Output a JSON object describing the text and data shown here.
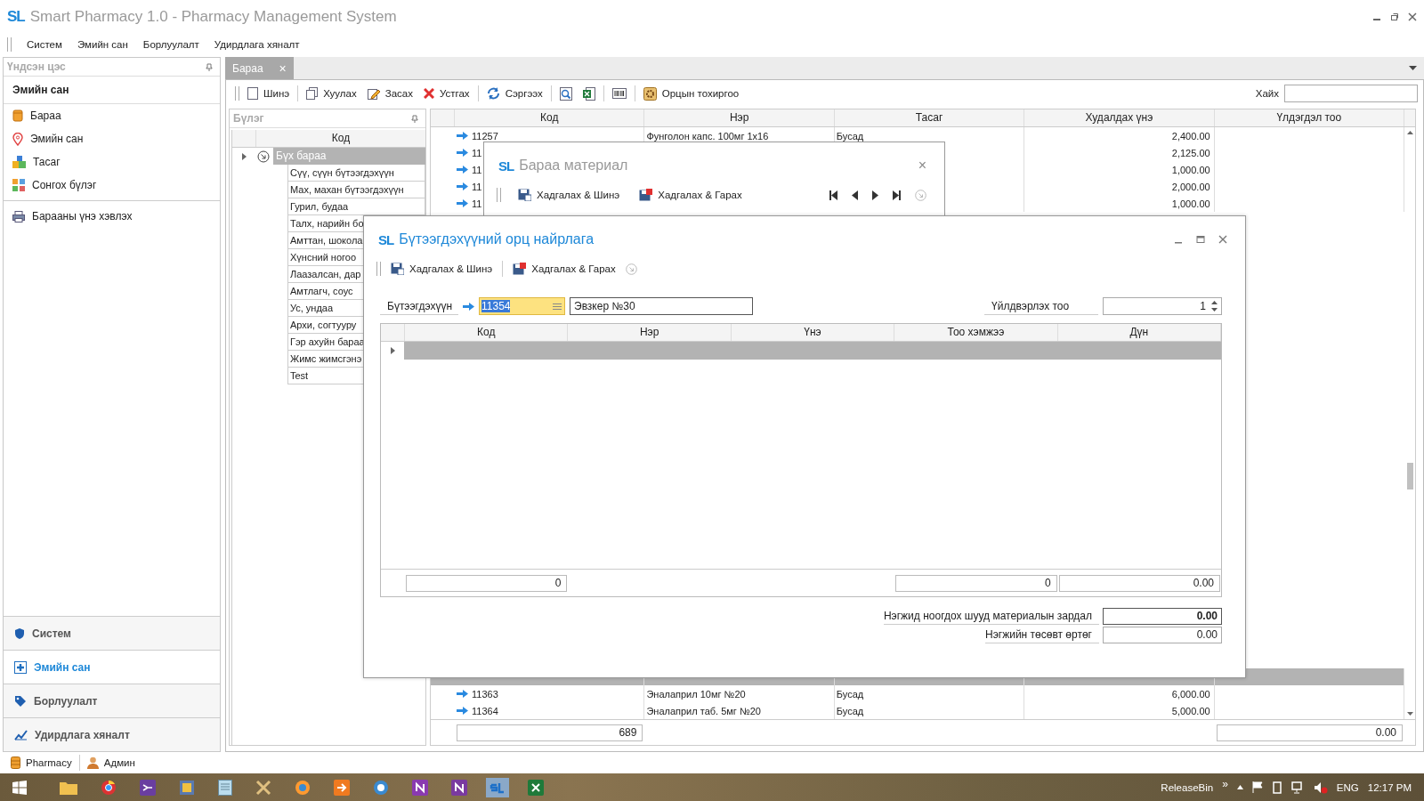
{
  "window": {
    "logo": "SL",
    "title": "Smart Pharmacy 1.0 - Pharmacy Management System"
  },
  "menu": [
    "Систем",
    "Эмийн сан",
    "Борлуулалт",
    "Удирдлага хяналт"
  ],
  "sidebar": {
    "header": "Үндсэн цэс",
    "section": "Эмийн сан",
    "items": [
      {
        "label": "Бараа",
        "kind": "product"
      },
      {
        "label": "Эмийн сан",
        "kind": "pin"
      },
      {
        "label": "Тасаг",
        "kind": "blocks"
      },
      {
        "label": "Сонгох бүлэг",
        "kind": "grid"
      },
      {
        "label": "Барааны үнэ хэвлэх",
        "kind": "printer"
      }
    ],
    "groups": [
      {
        "label": "Систем",
        "kind": "shield",
        "selected": false
      },
      {
        "label": "Эмийн сан",
        "kind": "cross",
        "selected": true
      },
      {
        "label": "Борлуулалт",
        "kind": "tag",
        "selected": false
      },
      {
        "label": "Удирдлага хяналт",
        "kind": "chart",
        "selected": false
      }
    ]
  },
  "tabs": [
    {
      "label": "Бараа",
      "close": "×",
      "selected": true
    }
  ],
  "toolbar": {
    "items": [
      {
        "label": "Шинэ",
        "kind": "page"
      },
      {
        "label": "Хуулах",
        "kind": "copy"
      },
      {
        "label": "Засах",
        "kind": "pencil"
      },
      {
        "label": "Устгах",
        "kind": "delete"
      },
      {
        "label": "Сэргээх",
        "kind": "refresh"
      },
      {
        "kind": "preview"
      },
      {
        "kind": "excel"
      },
      {
        "kind": "barcode"
      },
      {
        "label": "Орцын тохиргоо",
        "kind": "gear"
      }
    ],
    "search_label": "Хайх"
  },
  "group_panel": {
    "title": "Бүлэг",
    "column": "Код",
    "root": {
      "label": "Бүх бараа",
      "selected": true,
      "expanded": false
    },
    "children": [
      "Сүү, сүүн бүтээгдэхүүн",
      "Мах, махан бүтээгдэхүүн",
      "Гурил, будаа",
      "Талх, нарийн бо",
      "Амттан, шокола",
      "Хүнсний ногоо",
      "Лаазалсан, дар",
      "Амтлагч, соус",
      "Ус, ундаа",
      "Архи, согтууру",
      "Гэр ахуйн бараа",
      "Жимс жимсгэнэ",
      "Test"
    ]
  },
  "grid": {
    "columns": [
      "Код",
      "Нэр",
      "Тасаг",
      "Худалдах үнэ",
      "Үлдэгдэл тоо"
    ],
    "rows_top": [
      {
        "code": "11257",
        "name": "Фунголон капс. 100мг 1x16",
        "category": "Бусад",
        "price": "2,400.00",
        "selected": false
      },
      {
        "code": "11",
        "price": "2,125.00",
        "selected": false
      },
      {
        "code": "11",
        "price": "1,000.00",
        "selected": false
      },
      {
        "code": "11",
        "price": "2,000.00",
        "selected": false
      },
      {
        "code": "11",
        "price": "1,000.00",
        "selected": false
      }
    ],
    "rows_bottom": [
      {
        "selected": true
      },
      {
        "code": "11363",
        "name": "Эналаприл 10мг №20",
        "category": "Бусад",
        "price": "6,000.00",
        "selected": false
      },
      {
        "code": "11364",
        "name": "Эналаприл таб. 5мг №20",
        "category": "Бусад",
        "price": "5,000.00",
        "selected": false
      }
    ],
    "footer": {
      "code_total": "689",
      "stock_total": "0.00"
    }
  },
  "dialog_material": {
    "logo": "SL",
    "title": "Бараа материал",
    "close": "×",
    "buttons": [
      "Хадгалах & Шинэ",
      "Хадгалах & Гарах"
    ]
  },
  "dialog_recipe": {
    "logo": "SL",
    "title": "Бүтээгдэхүүний орц найрлага",
    "buttons": [
      "Хадгалах & Шинэ",
      "Хадгалах & Гарах"
    ],
    "product_label": "Бүтээгдэхүүн",
    "product_code": "11354",
    "product_name": "Эвзкер №30",
    "quantity_label": "Үйлдвэрлэх тоо",
    "quantity": "1",
    "columns": [
      "Код",
      "Нэр",
      "Үнэ",
      "Тоо хэмжээ",
      "Дүн"
    ],
    "rows": [
      {
        "selected": true
      }
    ],
    "footer": {
      "code": "0",
      "quantity": "0",
      "amount": "0.00"
    },
    "summary": [
      {
        "label": "Нэгжид ноогдох шууд материалын зардал",
        "value": "0.00",
        "bold": true
      },
      {
        "label": "Нэгжийн төсөвт өртөг",
        "value": "0.00",
        "bold": false
      }
    ]
  },
  "status_bar": [
    {
      "label": "Pharmacy",
      "kind": "db"
    },
    {
      "label": "Админ",
      "kind": "user"
    }
  ],
  "taskbar": {
    "folder": "ReleaseBin",
    "more": "»",
    "language": "ENG",
    "time": "12:17 PM"
  }
}
